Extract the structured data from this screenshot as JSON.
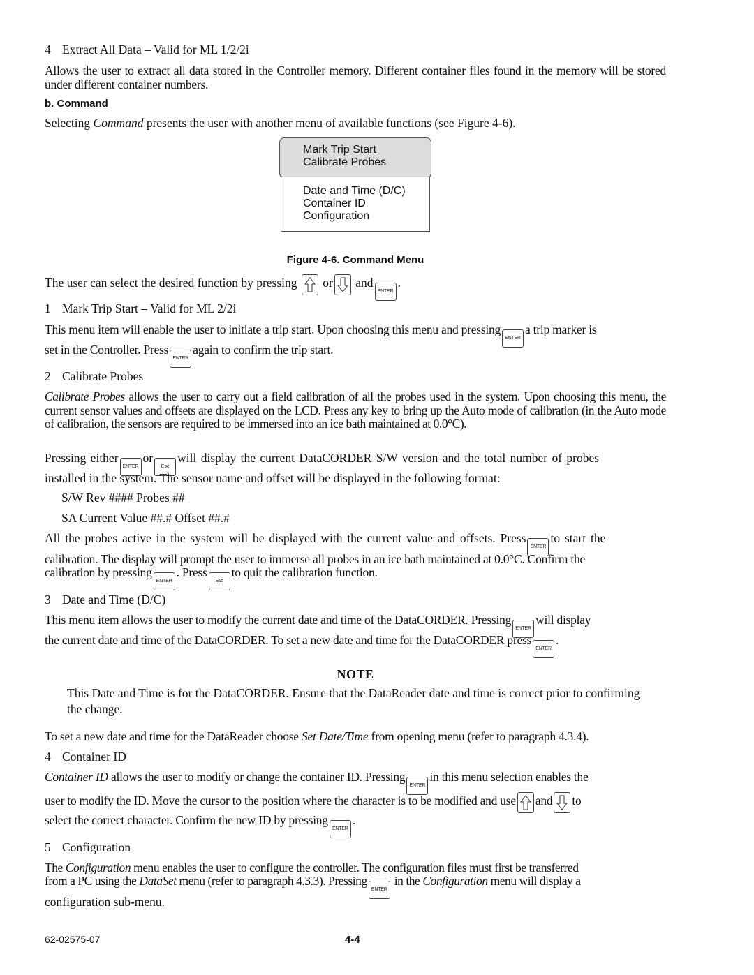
{
  "sections": {
    "extract": {
      "num": "4",
      "heading": "Extract All Data – Valid for ML 1/2/2i",
      "body": "Allows the user to extract all data stored in the Controller memory. Different container files found in the memory will be stored under different container numbers."
    },
    "command": {
      "heading": "b.  Command",
      "intro_pre": "Selecting ",
      "intro_em": "Command",
      "intro_post": " presents the user with another menu of available functions (see Figure 4-6)."
    }
  },
  "figure": {
    "menu_top": [
      "Mark Trip Start",
      "Calibrate Probes"
    ],
    "menu_bottom": [
      "Date and Time (D/C)",
      "Container ID",
      "Configuration"
    ],
    "caption": "Figure 4-6. Command Menu"
  },
  "keys": {
    "enter": "ENTER",
    "esc": "Esc"
  },
  "select_line": {
    "pre": "The user can select the desired function by pressing",
    "or": "or",
    "and": "and",
    "end": "."
  },
  "items": {
    "mark_trip": {
      "num": "1",
      "heading": "Mark Trip Start – Valid for ML 2/2i",
      "p1_a": "This menu item will enable the user to initiate a trip start. Upon choosing this menu and pressing",
      "p1_b": "a trip marker is",
      "p2_a": "set in the Controller. Press",
      "p2_b": "again to confirm the trip start."
    },
    "calibrate": {
      "num": "2",
      "heading": "Calibrate Probes",
      "p1_em": "Calibrate Probes",
      "p1": " allows the user to carry out a field calibration of all the probes used in the system. Upon choosing this menu, the current sensor values and offsets are displayed on the LCD. Press any key to bring up the Auto mode of calibration (in the Auto mode of calibration, the sensors are required to be immersed into an ice bath maintained at 0.0°C).",
      "p2_a": "Pressing either",
      "p2_or": "or",
      "p2_b": "will display the current DataCORDER S/W version and the total number of probes",
      "p2_c": "installed in the system. The sensor name and offset will be displayed in the following format:",
      "format1": "S/W Rev #### Probes ##",
      "format2": "SA Current Value ##.# Offset ##.#",
      "p3_a": "All the probes active in the system will be displayed with the current value and offsets. Press",
      "p3_b": "to start the",
      "p3_c": "calibration. The display will prompt the user to immerse all probes in an ice bath maintained at 0.0°C. Confirm the",
      "p3_d": "calibration by pressing",
      "p3_e": ". Press",
      "p3_f": "to quit the calibration function."
    },
    "datetime": {
      "num": "3",
      "heading": "Date and Time (D/C)",
      "p1_a": "This menu item allows the user to modify the current date and time of the DataCORDER. Pressing",
      "p1_b": "will display",
      "p2_a": "the current date and time of the DataCORDER. To set a new date and time for the DataCORDER press",
      "p2_b": ".",
      "note_title": "NOTE",
      "note_body": "This Date and Time is for the DataCORDER. Ensure that the DataReader date and time is correct prior to confirming the change.",
      "p3_a": "To set a new date and time for the DataReader choose ",
      "p3_em": "Set Date/Time",
      "p3_b": " from opening menu (refer to paragraph 4.3.4)."
    },
    "container": {
      "num": "4",
      "heading": "Container ID",
      "p1_em": "Container ID",
      "p1_a": " allows the user to modify or change the container ID. Pressing",
      "p1_b": "in this menu selection enables the",
      "p2_a": "user to modify the ID. Move the cursor to the position where the character is to be modified and use",
      "p2_and": "and",
      "p2_b": "to",
      "p3_a": "select the correct character. Confirm the new ID by pressing",
      "p3_b": "."
    },
    "configuration": {
      "num": "5",
      "heading": "Configuration",
      "p1_a": "The ",
      "p1_em": "Configuration",
      "p1_b": " menu enables the user to configure the controller. The configuration files must first be transferred",
      "p2_a": "from a PC using the ",
      "p2_em": "DataSet",
      "p2_b": " menu (refer to paragraph 4.3.3). Pressing",
      "p2_c": " in the ",
      "p2_em2": "Configuration",
      "p2_d": " menu will display a",
      "p3": "configuration sub-menu."
    }
  },
  "footer": {
    "doc_number": "62-02575-07",
    "page_number": "4-4"
  }
}
